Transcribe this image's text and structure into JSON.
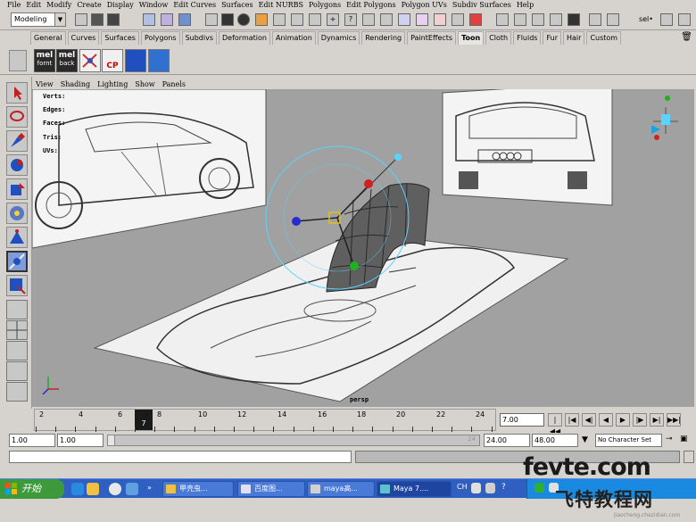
{
  "menubar": [
    "File",
    "Edit",
    "Modify",
    "Create",
    "Display",
    "Window",
    "Edit Curves",
    "Surfaces",
    "Edit NURBS",
    "Polygons",
    "Edit Polygons",
    "Polygon UVs",
    "Subdiv Surfaces",
    "Help"
  ],
  "statusline": {
    "mode": "Modeling",
    "sel_label": "sel•"
  },
  "shelf_tabs": [
    "General",
    "Curves",
    "Surfaces",
    "Polygons",
    "Subdivs",
    "Deformation",
    "Animation",
    "Dynamics",
    "Rendering",
    "PaintEffects",
    "Toon",
    "Cloth",
    "Fluids",
    "Fur",
    "Hair",
    "Custom"
  ],
  "active_shelf_tab": "Toon",
  "shelf_buttons": [
    {
      "top": "mel",
      "bottom": "fornt"
    },
    {
      "top": "mel",
      "bottom": "back"
    }
  ],
  "shelf_cp_label": "CP",
  "panel_menu": [
    "View",
    "Shading",
    "Lighting",
    "Show",
    "Panels"
  ],
  "hud": {
    "verts": "Verts:",
    "edges": "Edges:",
    "faces": "Faces:",
    "tris": "Tris:",
    "uvs": "UVs:"
  },
  "viewport_camera": "persp",
  "timeline": {
    "ticks": [
      "2",
      "4",
      "6",
      "8",
      "10",
      "12",
      "14",
      "16",
      "18",
      "20",
      "22",
      "24"
    ],
    "current_frame": "7",
    "current_field": "7.00"
  },
  "range": {
    "start": "1.00",
    "playback_start": "1.00",
    "playback_end_ghost": "24",
    "playback_end": "24.00",
    "end": "48.00",
    "character_set": "No Character Set"
  },
  "taskbar": {
    "start": "开始",
    "buttons": [
      "甲壳虫...",
      "百度图...",
      "maya高...",
      "Maya 7...."
    ],
    "lang": "CH"
  },
  "watermark": {
    "main": "fevte.com",
    "sub": "飞特教程网",
    "url": "jiaocheng.chazidian.com"
  },
  "colors": {
    "ui_gray": "#d6d3ce",
    "viewport_bg": "#a1a1a1",
    "taskbar_blue": "#2e5fc1",
    "start_green": "#3c9a3c",
    "manip_cyan": "#5bd3ff"
  }
}
